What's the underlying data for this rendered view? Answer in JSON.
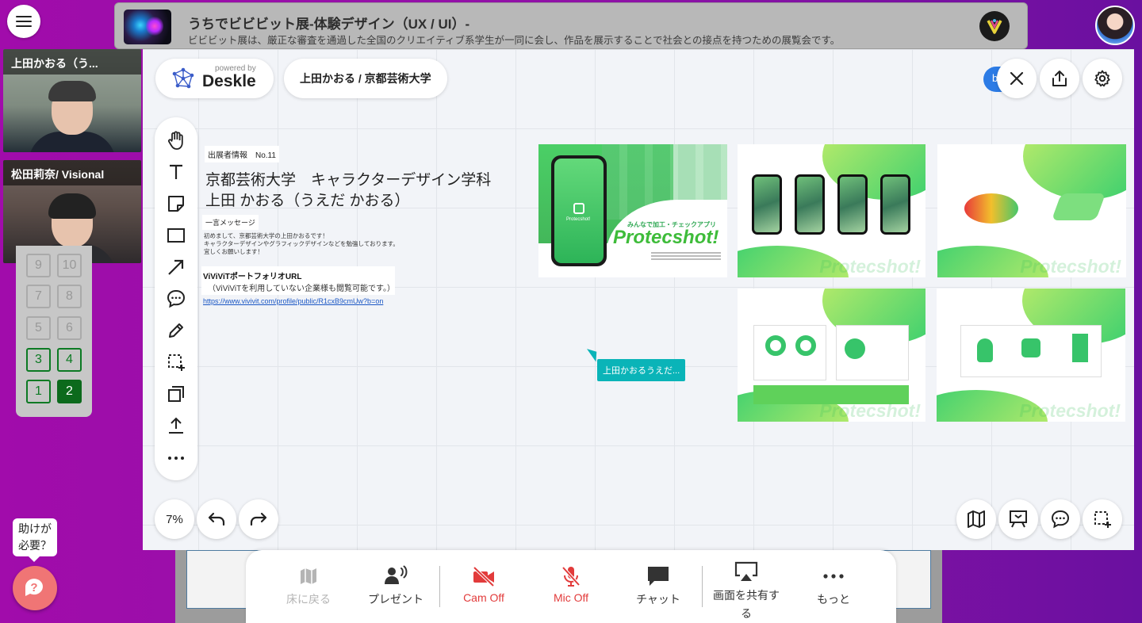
{
  "banner": {
    "title": "うちでビビビット展-体験デザイン（UX / UI）-",
    "subtitle": "ビビビット展は、厳正な審査を通過した全国のクリエイティブ系学生が一同に会し、作品を展示することで社会との接点を持つための展覧会です。"
  },
  "videos": [
    {
      "name": "上田かおる（う..."
    },
    {
      "name": "松田莉奈/ Visional"
    }
  ],
  "elevator": {
    "buttons": [
      {
        "label": "9",
        "state": "disabled"
      },
      {
        "label": "10",
        "state": "disabled"
      },
      {
        "label": "7",
        "state": "disabled"
      },
      {
        "label": "8",
        "state": "disabled"
      },
      {
        "label": "5",
        "state": "disabled"
      },
      {
        "label": "6",
        "state": "disabled"
      },
      {
        "label": "3",
        "state": "active"
      },
      {
        "label": "4",
        "state": "active"
      },
      {
        "label": "1",
        "state": "active"
      },
      {
        "label": "2",
        "state": "current"
      }
    ]
  },
  "help": {
    "bubble": "助けが必要？"
  },
  "deskle": {
    "powered_by": "powered by",
    "logo": "Deskle",
    "board_title": "上田かおる / 京都芸術大学",
    "user_chip": "b",
    "zoom": "7%",
    "board": {
      "info_label": "出展者情報　No.11",
      "school": "京都芸術大学　キャラクターデザイン学科",
      "name": "上田 かおる（うえだ かおる）",
      "message_label": "一言メッセージ",
      "message_line1": "初めまして、京都芸術大学の上田かおるです！",
      "message_line2": "キャラクターデザインやグラフィックデザインなどを勉強しております。",
      "message_line3": "宜しくお願いします！",
      "url_title": "ViViViTポートフォリオURL",
      "url_note": "（ViViViTを利用していない企業様も閲覧可能です。）",
      "url": "https://www.vivivit.com/profile/public/R1cxB9cmUw?b=on",
      "cover_tagline": "みんなで加工・チェックアプリ",
      "cover_title": "Protecshot!",
      "watermark": "Protecshot!",
      "cursor_user": "上田かおるうえだ..."
    }
  },
  "bottombar": {
    "items": [
      {
        "label": "床に戻る",
        "icon": "map-icon",
        "state": "disabled"
      },
      {
        "label": "プレゼント",
        "icon": "present-icon",
        "state": "normal"
      },
      {
        "label": "Cam Off",
        "icon": "camera-off-icon",
        "state": "off"
      },
      {
        "label": "Mic Off",
        "icon": "mic-off-icon",
        "state": "off"
      },
      {
        "label": "チャット",
        "icon": "chat-icon",
        "state": "normal"
      },
      {
        "label": "画面を共有する",
        "icon": "screen-share-icon",
        "state": "normal"
      },
      {
        "label": "もっと",
        "icon": "more-icon",
        "state": "normal"
      }
    ]
  },
  "colors": {
    "background": "#a10cab",
    "off_red": "#e23b3b",
    "elevator_green": "#0c6a1c",
    "cursor_teal": "#0ab4b8",
    "app_green": "#2fcd6f"
  }
}
